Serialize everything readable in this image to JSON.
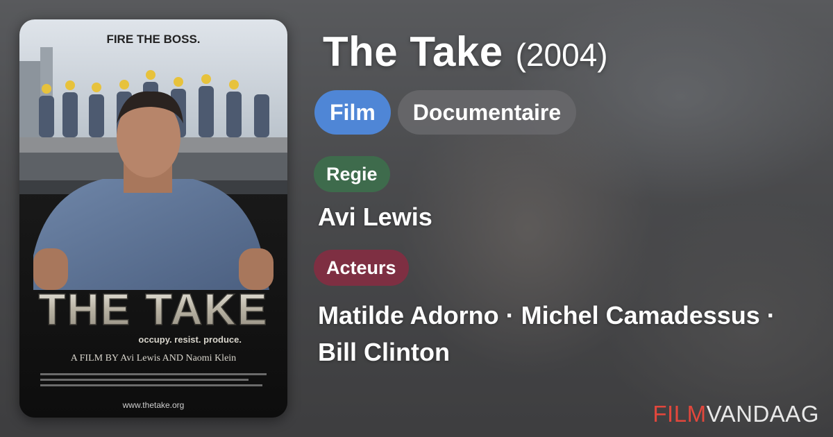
{
  "movie": {
    "title": "The Take",
    "year": "(2004)"
  },
  "chips": {
    "type": "Film",
    "genre": "Documentaire"
  },
  "regie": {
    "label": "Regie",
    "value": "Avi Lewis"
  },
  "acteurs": {
    "label": "Acteurs",
    "line1": "Matilde Adorno · Michel Camadessus ·",
    "line2": "Bill Clinton"
  },
  "poster": {
    "tagline": "FIRE THE BOSS.",
    "title": "THE TAKE",
    "subtitle": "occupy. resist. produce.",
    "credit": "A FILM BY Avi Lewis AND Naomi Klein",
    "url": "www.thetake.org"
  },
  "brand": {
    "part1": "FILM",
    "part2": "VANDAAG"
  },
  "colors": {
    "film_chip": "#4f86d6",
    "regie_chip": "#3e6b4c",
    "acteurs_chip": "#7e2f42",
    "brand_red": "#e2473c"
  }
}
